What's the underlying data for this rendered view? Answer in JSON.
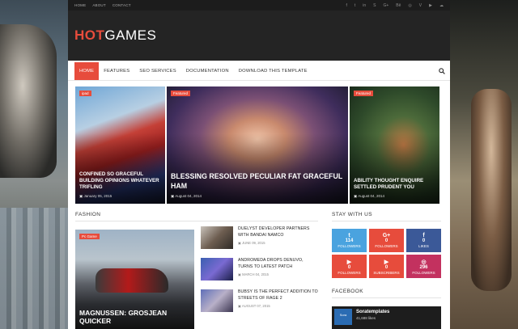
{
  "topbar": {
    "links": [
      "HOME",
      "ABOUT",
      "CONTACT"
    ],
    "social_icons": [
      "facebook-icon",
      "twitter-icon",
      "linkedin-icon",
      "skype-icon",
      "google-plus-icon",
      "behance-icon",
      "dribbble-icon",
      "vimeo-icon",
      "youtube-icon",
      "soundcloud-icon"
    ],
    "social_glyphs": [
      "f",
      "t",
      "in",
      "S",
      "G+",
      "Bē",
      "◎",
      "V",
      "▶",
      "☁"
    ]
  },
  "header": {
    "logo_hot": "HOT",
    "logo_games": "GAMES"
  },
  "nav": {
    "items": [
      "HOME",
      "FEATURES",
      "SEO SERVICES",
      "DOCUMENTATION",
      "DOWNLOAD THIS TEMPLATE"
    ],
    "active_index": 0
  },
  "featured": [
    {
      "tag": "ipad",
      "title": "CONFINED SO GRACEFUL BUILDING OPINIONS WHATEVER TRIFLING",
      "date": "January 05, 2015"
    },
    {
      "tag": "Featured",
      "title": "BLESSING RESOLVED PECULIAR FAT GRACEFUL HAM",
      "date": "August 04, 2014"
    },
    {
      "tag": "Featured",
      "title": "ABILITY THOUGHT ENQUIRE SETTLED PRUDENT YOU",
      "date": "August 04, 2014"
    }
  ],
  "fashion": {
    "heading": "FASHION",
    "big": {
      "tag": "Pc Game",
      "title": "MAGNUSSEN: GROSJEAN QUICKER"
    },
    "list": [
      {
        "title": "DUELYST DEVELOPER PARTNERS WITH BANDAI NAMCO",
        "date": "JUNE 09, 2015"
      },
      {
        "title": "ANDROMEDA DROPS DENUVO, TURNS TO LATEST PATCH",
        "date": "MARCH 04, 2015"
      },
      {
        "title": "BUBSY IS THE PERFECT ADDITION TO STREETS OF RAGE 2",
        "date": "AUGUST 07, 2015"
      }
    ]
  },
  "sidebar": {
    "stay_heading": "STAY WITH US",
    "follow": [
      {
        "glyph": "t",
        "count": "114",
        "label": "FOLLOWERS"
      },
      {
        "glyph": "G+",
        "count": "0",
        "label": "FOLLOWERS"
      },
      {
        "glyph": "f",
        "count": "0",
        "label": "LIKES"
      },
      {
        "glyph": "▶",
        "count": "0",
        "label": "FOLLOWERS"
      },
      {
        "glyph": "▶",
        "count": "0",
        "label": "SUBSCRIBERS"
      },
      {
        "glyph": "◎",
        "count": "296",
        "label": "FOLLOWERS"
      }
    ],
    "facebook_heading": "FACEBOOK",
    "facebook": {
      "page_name": "Soratemplates",
      "likes": "41,688 likes",
      "logo_text": "Sora"
    }
  },
  "colors": {
    "accent": "#e74c3c",
    "twitter": "#4aa3df",
    "facebook": "#3b5998",
    "instagram": "#c3315f"
  }
}
